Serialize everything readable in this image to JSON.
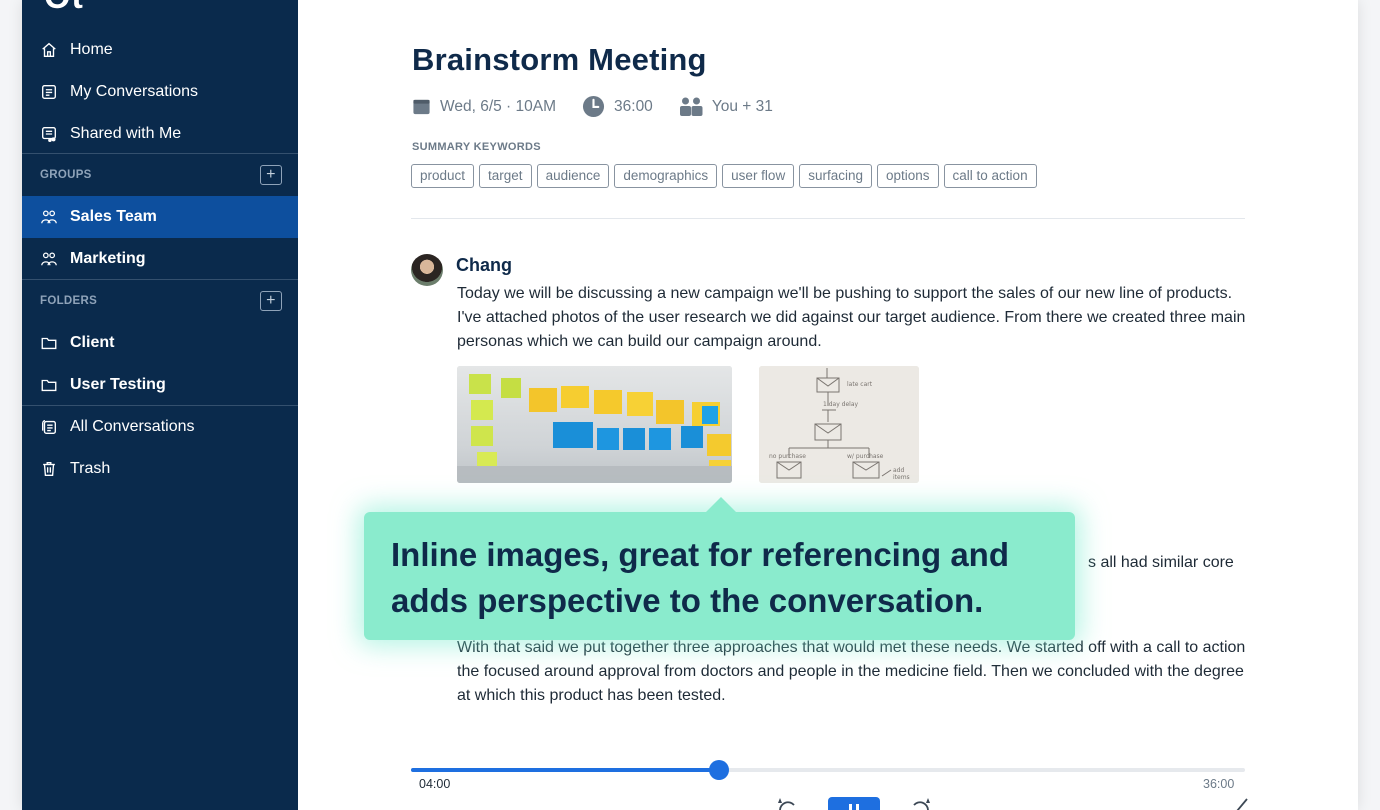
{
  "sidebar": {
    "logo": "Ot",
    "nav": [
      {
        "label": "Home"
      },
      {
        "label": "My Conversations"
      },
      {
        "label": "Shared with Me"
      }
    ],
    "groups_header": "GROUPS",
    "groups": [
      {
        "label": "Sales Team",
        "active": true
      },
      {
        "label": "Marketing",
        "active": false
      }
    ],
    "folders_header": "FOLDERS",
    "folders": [
      {
        "label": "Client"
      },
      {
        "label": "User Testing"
      }
    ],
    "bottom": [
      {
        "label": "All Conversations"
      },
      {
        "label": "Trash"
      }
    ]
  },
  "meeting": {
    "title": "Brainstorm Meeting",
    "date": "Wed, 6/5 · 10AM",
    "duration": "36:00",
    "participants": "You + 31",
    "keywords_label": "SUMMARY KEYWORDS",
    "keywords": [
      "product",
      "target",
      "audience",
      "demographics",
      "user flow",
      "surfacing",
      "options",
      "call to action"
    ]
  },
  "transcript": {
    "speaker": "Chang",
    "paragraph1": "Today we will be discussing a new campaign we'll be pushing to support the sales of our new line of products. I've attached photos of the user research we did against our target audience. From there we created three main personas which we can build our campaign around.",
    "paragraph2_tail": "s all had similar core",
    "paragraph3": "With that said we put together three approaches that would met these needs. We started off with a call to action the focused around approval from doctors and people in the medicine field. Then we concluded with the degree at which this product has been tested."
  },
  "callout": {
    "text": "Inline images, great for referencing and adds perspective to the conversation."
  },
  "player": {
    "current_time": "04:00",
    "total_time": "36:00",
    "progress_fraction": 0.369
  },
  "colors": {
    "sidebar_bg": "#0a2a4c",
    "active_item": "#0d4f9e",
    "accent": "#1e6fe0",
    "callout_bg": "#8aebcd",
    "title_text": "#0f2a4a"
  }
}
